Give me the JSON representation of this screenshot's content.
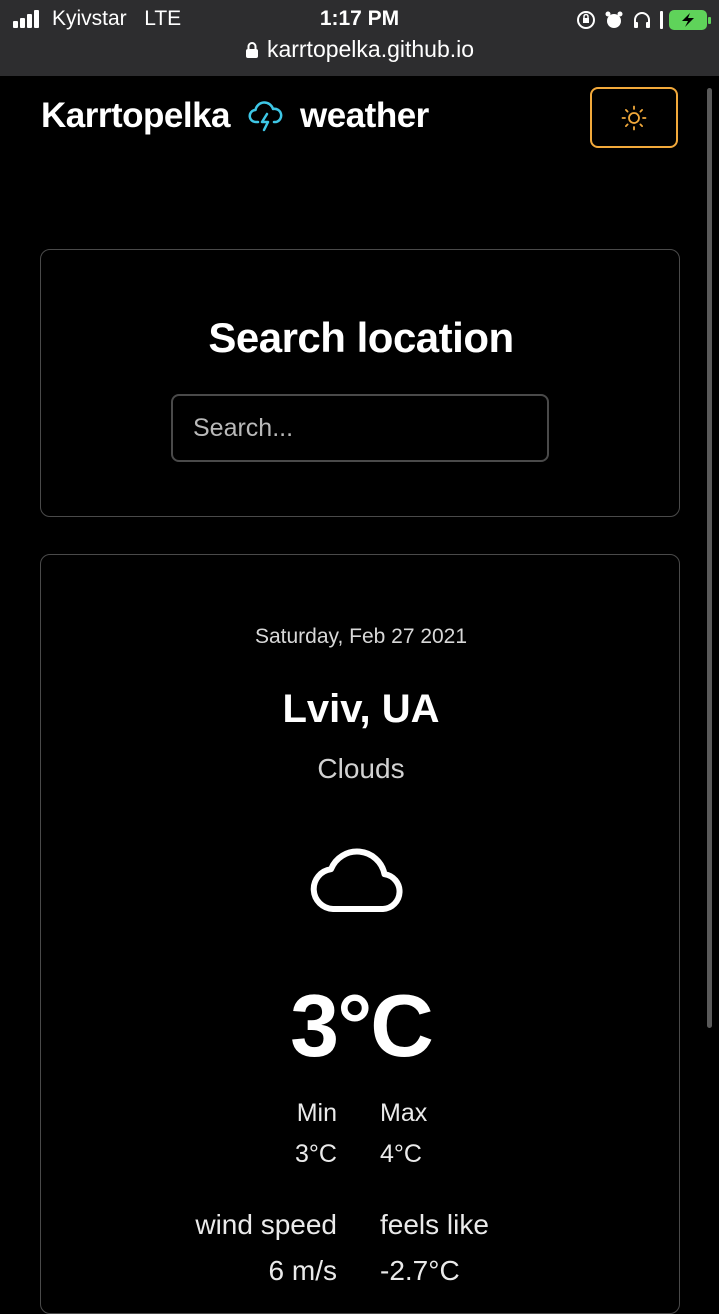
{
  "status_bar": {
    "carrier": "Kyivstar",
    "network": "LTE",
    "time": "1:17 PM",
    "url": "karrtopelka.github.io",
    "icons": [
      "orientation-lock-icon",
      "alarm-icon",
      "headphones-icon",
      "battery-charging-icon"
    ],
    "battery_color": "#5fd35a"
  },
  "header": {
    "brand_left": "Karrtopelka",
    "brand_right": "weather",
    "logo_icon": "cloud-lightning-icon",
    "logo_color": "#3ec7e6",
    "theme_toggle_icon": "sun-icon",
    "accent": "#f2a93b"
  },
  "search": {
    "title": "Search location",
    "placeholder": "Search..."
  },
  "weather": {
    "date": "Saturday, Feb 27 2021",
    "city": "Lviv, UA",
    "condition": "Clouds",
    "condition_icon": "cloud-icon",
    "temperature": "3°C",
    "min_label": "Min",
    "min_value": "3°C",
    "max_label": "Max",
    "max_value": "4°C",
    "wind_label": "wind speed",
    "wind_value": "6 m/s",
    "feels_label": "feels like",
    "feels_value": "-2.7°C"
  }
}
